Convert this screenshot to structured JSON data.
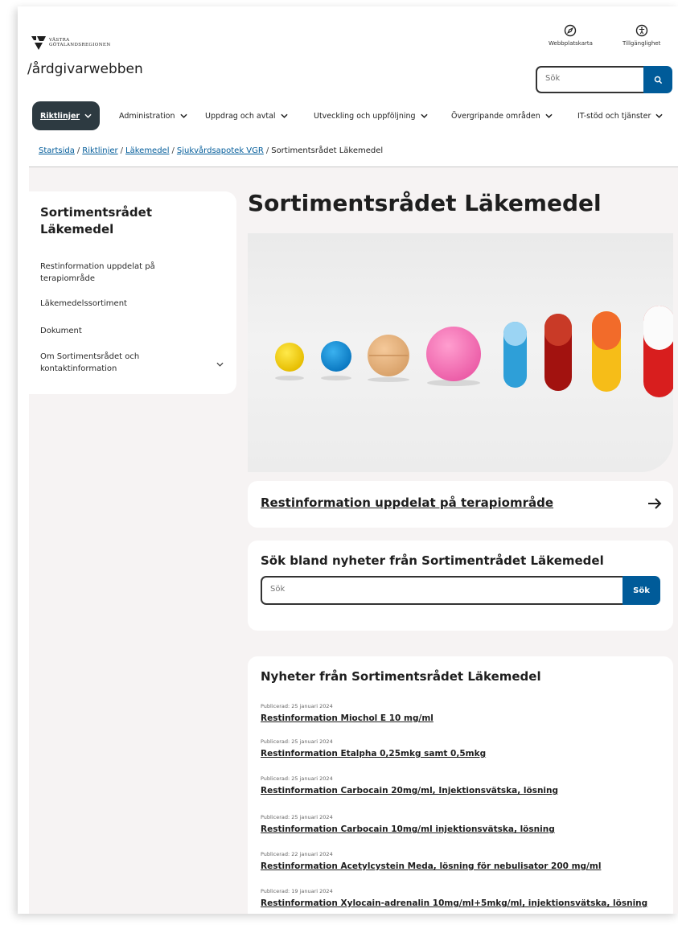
{
  "header": {
    "logo_line1": "VÄSTRA",
    "logo_line2": "GÖTALANDSREGIONEN",
    "site_name": "/årdgivarwebben",
    "sitemap_label": "Webbplatskarta",
    "accessibility_label": "Tillgänglighet",
    "search_placeholder": "Sök"
  },
  "nav": {
    "items": [
      {
        "label": "Riktlinjer",
        "active": true
      },
      {
        "label": "Administration"
      },
      {
        "label": "Uppdrag och avtal"
      },
      {
        "label": "Utveckling och uppföljning"
      },
      {
        "label": "Övergripande områden"
      },
      {
        "label": "IT-stöd och tjänster"
      }
    ]
  },
  "breadcrumb": [
    "Startsida",
    "Riktlinjer",
    "Läkemedel",
    "Sjukvårdsapotek VGR",
    "Sortimentsrådet Läkemedel"
  ],
  "sidebar": {
    "title": "Sortimentsrådet Läkemedel",
    "items": [
      "Restinformation uppdelat på terapiområde",
      "Läkemedelssortiment",
      "Dokument",
      "Om Sortimentsrådet och kontaktinformation"
    ]
  },
  "main": {
    "title": "Sortimentsrådet Läkemedel",
    "link_card": "Restinformation uppdelat på terapiområde",
    "search_card": {
      "heading": "Sök bland nyheter från Sortimentrådet Läkemedel",
      "placeholder": "Sök",
      "button": "Sök"
    },
    "news": {
      "heading": "Nyheter från Sortimentsrådet Läkemedel",
      "items": [
        {
          "date": "Publicerad: 25 januari 2024",
          "title": "Restinformation Miochol E 10 mg/ml"
        },
        {
          "date": "Publicerad: 25 januari 2024",
          "title": "Restinformation Etalpha 0,25mkg samt 0,5mkg"
        },
        {
          "date": "Publicerad: 25 januari 2024",
          "title": "Restinformation Carbocain 20mg/ml, Injektionsvätska, lösning"
        },
        {
          "date": "Publicerad: 25 januari 2024",
          "title": "Restinformation Carbocain 10mg/ml injektionsvätska, lösning"
        },
        {
          "date": "Publicerad: 22 januari 2024",
          "title": "Restinformation Acetylcystein Meda, lösning för nebulisator 200 mg/ml"
        },
        {
          "date": "Publicerad: 19 januari 2024",
          "title": "Restinformation Xylocain-adrenalin 10mg/ml+5mkg/ml, injektionsvätska, lösning"
        }
      ]
    }
  },
  "colors": {
    "primary": "#005b99",
    "nav_active": "#2d3a41",
    "content_bg": "#f6f3f3"
  }
}
